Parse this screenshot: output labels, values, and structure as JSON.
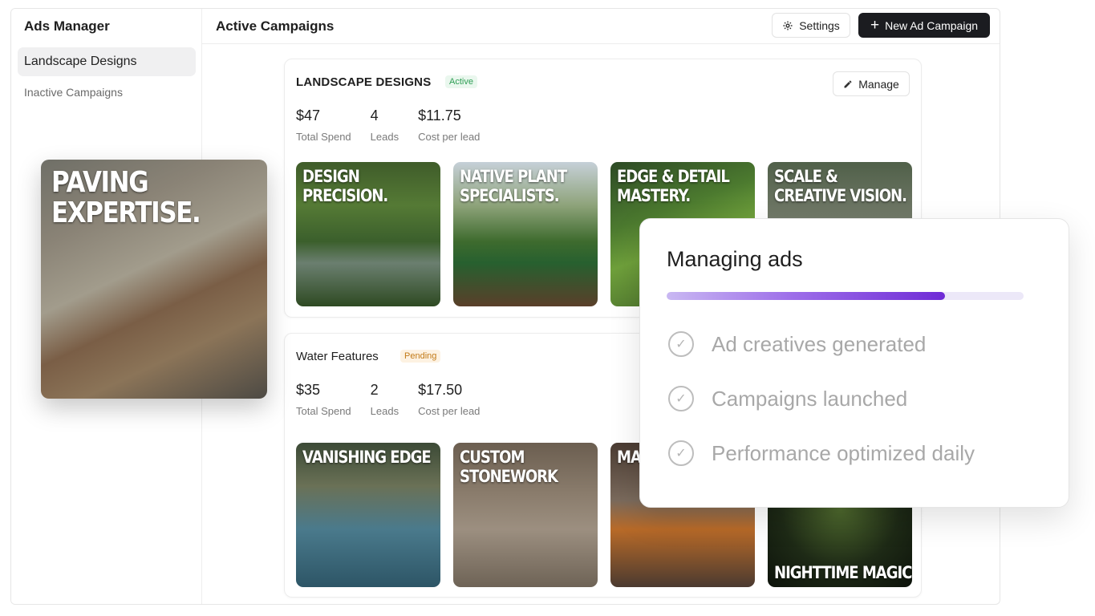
{
  "sidebar": {
    "app_title": "Ads Manager",
    "items": [
      {
        "label": "Landscape Designs",
        "active": true
      },
      {
        "label": "Inactive Campaigns",
        "active": false
      }
    ]
  },
  "header": {
    "title": "Active Campaigns",
    "settings_label": "Settings",
    "new_campaign_label": "New Ad Campaign"
  },
  "campaigns": [
    {
      "name": "LANDSCAPE DESIGNS",
      "status": "Active",
      "manage_label": "Manage",
      "stats": [
        {
          "value": "$47",
          "label": "Total Spend"
        },
        {
          "value": "4",
          "label": "Leads"
        },
        {
          "value": "$11.75",
          "label": "Cost per lead"
        }
      ],
      "ads": [
        {
          "text": "DESIGN PRECISION."
        },
        {
          "text": "NATIVE PLANT SPECIALISTS."
        },
        {
          "text": "EDGE & DETAIL MASTERY."
        },
        {
          "text": "SCALE & CREATIVE VISION."
        }
      ]
    },
    {
      "name": "Water Features",
      "status": "Pending",
      "stats": [
        {
          "value": "$35",
          "label": "Total Spend"
        },
        {
          "value": "2",
          "label": "Leads"
        },
        {
          "value": "$17.50",
          "label": "Cost per lead"
        }
      ],
      "ads": [
        {
          "text": "VANISHING EDGE"
        },
        {
          "text": "CUSTOM STONEWORK"
        },
        {
          "text": "MA HA MA"
        },
        {
          "text": "NIGHTTIME MAGIC"
        }
      ]
    }
  ],
  "hero_ad": {
    "text": "PAVING EXPERTISE."
  },
  "overlay": {
    "title": "Managing ads",
    "progress": 0.78,
    "steps": [
      {
        "label": "Ad creatives generated"
      },
      {
        "label": "Campaigns launched"
      },
      {
        "label": "Performance optimized daily"
      }
    ]
  },
  "colors": {
    "accent": "#6f2bd6",
    "active_badge": "#2f9e55",
    "pending_badge": "#c27a18",
    "primary_button": "#1b1c20"
  },
  "icons": {
    "settings": "gear-icon",
    "new_campaign": "plus-icon",
    "manage": "pencil-icon",
    "step": "check-circle-icon"
  }
}
